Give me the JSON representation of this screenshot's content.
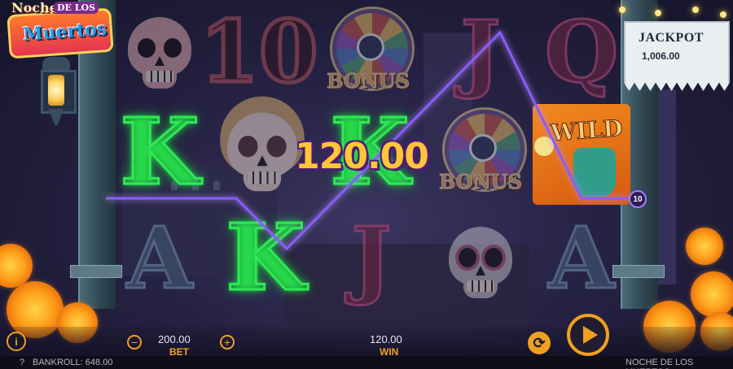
{
  "logo": {
    "line1": "Noche",
    "line2": "DE LOS",
    "line3": "Muertos"
  },
  "jackpot": {
    "label": "JACKPOT",
    "amount": "1,006.00"
  },
  "reels": {
    "row1": [
      "skull-red",
      "10",
      "BONUS",
      "J",
      "Q"
    ],
    "row2": [
      "K",
      "woman-skull",
      "K",
      "BONUS",
      "WILD"
    ],
    "row3": [
      "A",
      "K",
      "J",
      "skull-grey",
      "A"
    ],
    "bonus_label": "BONUS",
    "wild_label": "WILD"
  },
  "win": {
    "big_amount": "120.00",
    "line_number": "10"
  },
  "controls": {
    "info_label": "i",
    "minus_label": "−",
    "plus_label": "+",
    "bet_value": "200.00",
    "bet_caption": "BET",
    "win_value": "120.00",
    "win_caption": "WIN",
    "autoplay_label": "⟳"
  },
  "status": {
    "help_glyph": "?",
    "bankroll": "BANKROLL: 648.00",
    "game_name": "NOCHE DE LOS MUERTOS"
  },
  "colors": {
    "neon_green": "#2eea55",
    "accent_orange": "#f0a020",
    "payline_purple": "#8a5cff",
    "win_gold": "#ffc63a"
  },
  "icons": [
    "info-icon",
    "help-icon",
    "minus-icon",
    "plus-icon",
    "autoplay-icon",
    "spin-icon",
    "lantern-icon"
  ]
}
